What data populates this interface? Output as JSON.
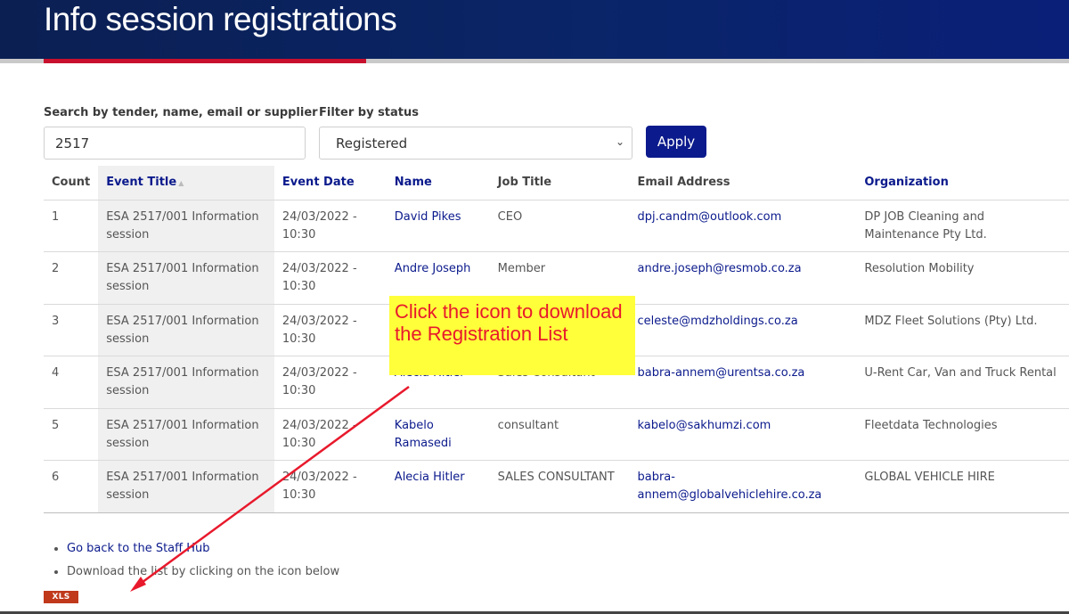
{
  "page": {
    "title": "Info session registrations"
  },
  "search": {
    "label": "Search by tender, name, email or supplier",
    "value": "2517"
  },
  "filter": {
    "label": "Filter by status",
    "selected": "Registered"
  },
  "apply_label": "Apply",
  "table": {
    "columns": [
      "Count",
      "Event Title",
      "Event Date",
      "Name",
      "Job Title",
      "Email Address",
      "Organization"
    ],
    "rows": [
      [
        "1",
        "ESA 2517/001 Information session",
        "24/03/2022 - 10:30",
        "David Pikes",
        "CEO",
        "dpj.candm@outlook.com",
        "DP JOB Cleaning and Maintenance Pty Ltd."
      ],
      [
        "2",
        "ESA 2517/001 Information session",
        "24/03/2022 - 10:30",
        "Andre Joseph",
        "Member",
        "andre.joseph@resmob.co.za",
        "Resolution Mobility"
      ],
      [
        "3",
        "ESA 2517/001 Information session",
        "24/03/2022 - 10:30",
        "",
        "",
        "celeste@mdzholdings.co.za",
        "MDZ Fleet Solutions (Pty) Ltd."
      ],
      [
        "4",
        "ESA 2517/001 Information session",
        "24/03/2022 - 10:30",
        "Alecia Hitler",
        "Sales Consultant",
        "babra-annem@urentsa.co.za",
        "U-Rent Car, Van and Truck Rental"
      ],
      [
        "5",
        "ESA 2517/001 Information session",
        "24/03/2022 - 10:30",
        "Kabelo Ramasedi",
        "consultant",
        "kabelo@sakhumzi.com",
        "Fleetdata Technologies"
      ],
      [
        "6",
        "ESA 2517/001 Information session",
        "24/03/2022 - 10:30",
        "Alecia Hitler",
        "SALES CONSULTANT",
        "babra-annem@globalvehiclehire.co.za",
        "GLOBAL VEHICLE HIRE"
      ]
    ]
  },
  "links": {
    "back": "Go back to the Staff Hub",
    "download_text": "Download the list by clicking on the icon below"
  },
  "xls_label": "XLS",
  "annotation": {
    "text": "Click the icon to download the Registration List",
    "color": "#e8192c"
  },
  "colors": {
    "header": "#0a2568",
    "accent": "#c8102e",
    "link": "#0b1a8c",
    "apply": "#0b1a8c"
  }
}
